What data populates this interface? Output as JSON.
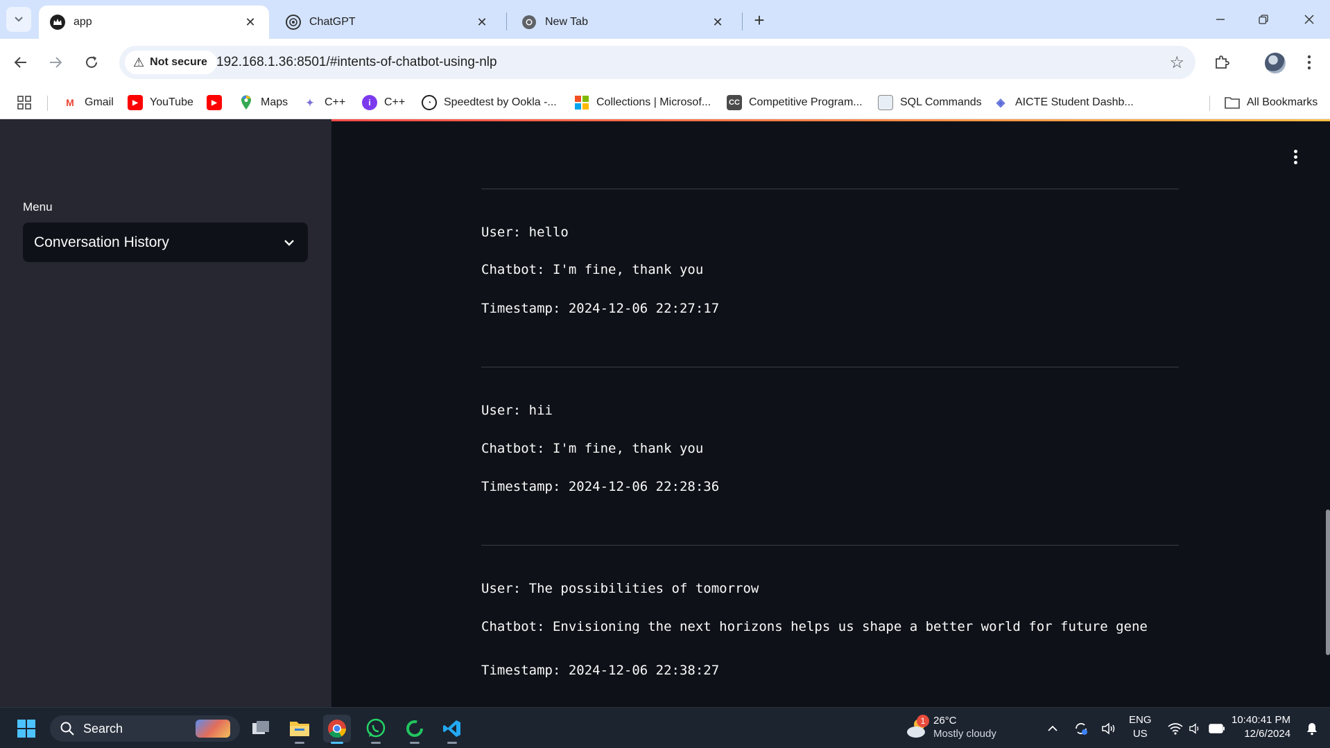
{
  "browser": {
    "tabs": [
      {
        "title": "app",
        "active": true
      },
      {
        "title": "ChatGPT",
        "active": false
      },
      {
        "title": "New Tab",
        "active": false
      }
    ],
    "security_label": "Not secure",
    "url": "192.168.1.36:8501/#intents-of-chatbot-using-nlp",
    "bookmarks": [
      {
        "label": "Gmail"
      },
      {
        "label": "YouTube"
      },
      {
        "label": ""
      },
      {
        "label": "Maps"
      },
      {
        "label": "C++"
      },
      {
        "label": "C++"
      },
      {
        "label": "Speedtest by Ookla -..."
      },
      {
        "label": "Collections | Microsof..."
      },
      {
        "label": "Competitive Program..."
      },
      {
        "label": "SQL Commands"
      },
      {
        "label": "AICTE Student Dashb..."
      }
    ],
    "all_bookmarks": "All Bookmarks"
  },
  "sidebar": {
    "menu_label": "Menu",
    "selected_option": "Conversation History"
  },
  "conversations": [
    {
      "user": "User: hello",
      "bot": "Chatbot: I'm fine, thank you",
      "timestamp": "Timestamp: 2024-12-06 22:27:17"
    },
    {
      "user": "User: hii",
      "bot": "Chatbot: I'm fine, thank you",
      "timestamp": "Timestamp: 2024-12-06 22:28:36"
    },
    {
      "user": "User: The possibilities of tomorrow",
      "bot": "Chatbot: Envisioning the next horizons helps us shape a better world for future gene",
      "timestamp": "Timestamp: 2024-12-06 22:38:27"
    }
  ],
  "taskbar": {
    "search_placeholder": "Search",
    "weather_temp": "26°C",
    "weather_desc": "Mostly cloudy",
    "weather_badge": "1",
    "lang_top": "ENG",
    "lang_bottom": "US",
    "time": "10:40:41 PM",
    "date": "12/6/2024"
  },
  "colors": {
    "app_bg": "#0e1117",
    "sidebar_bg": "#262730",
    "accent_gradient": [
      "#ff4b4b",
      "#ffbd45"
    ],
    "chrome_tabstrip": "#d3e3fd"
  }
}
